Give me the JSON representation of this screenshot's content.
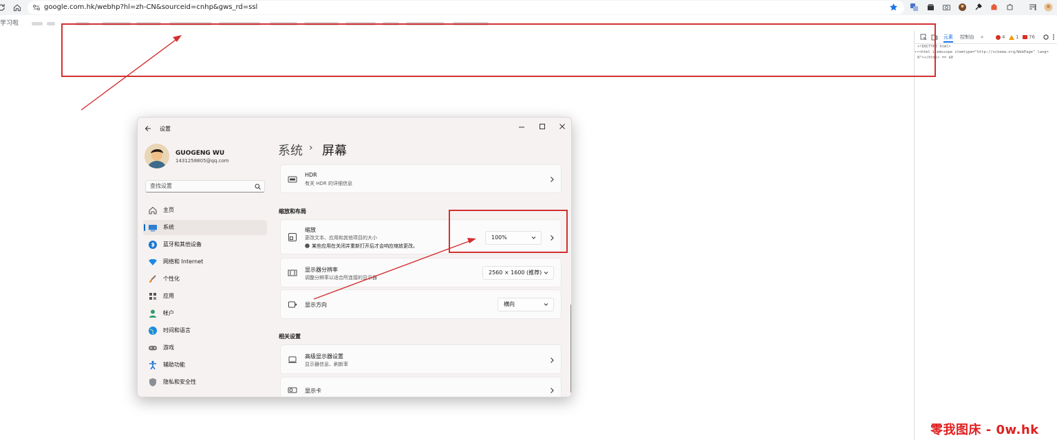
{
  "browser": {
    "url": "google.com.hk/webhp?hl=zh-CN&sourceid=cnhp&gws_rd=ssl",
    "bookmark_first": "学习啦"
  },
  "devtools": {
    "tabs": [
      "元素",
      "控制台",
      "»"
    ],
    "errors": "4",
    "warnings": "1",
    "messages": "76",
    "code_lines": [
      "<!DOCTYPE html>",
      "••<html itemscope itemtype=\"http://schema.org/WebPage\" lang=",
      "  8\"></html> == $0"
    ]
  },
  "settings": {
    "title": "设置",
    "user": {
      "name": "GUOGENG WU",
      "email": "1431258805@qq.com"
    },
    "search_placeholder": "查找设置",
    "nav": [
      {
        "label": "主页",
        "icon": "home-icon"
      },
      {
        "label": "系统",
        "icon": "system-icon",
        "selected": true
      },
      {
        "label": "蓝牙和其他设备",
        "icon": "bluetooth-icon"
      },
      {
        "label": "网络和 Internet",
        "icon": "network-icon"
      },
      {
        "label": "个性化",
        "icon": "brush-icon"
      },
      {
        "label": "应用",
        "icon": "apps-icon"
      },
      {
        "label": "帐户",
        "icon": "account-icon"
      },
      {
        "label": "时间和语言",
        "icon": "globe-icon"
      },
      {
        "label": "游戏",
        "icon": "gamepad-icon"
      },
      {
        "label": "辅助功能",
        "icon": "accessibility-icon"
      },
      {
        "label": "隐私和安全性",
        "icon": "shield-icon"
      }
    ],
    "breadcrumb": {
      "parent": "系统",
      "separator": "›",
      "current": "屏幕"
    },
    "hdr": {
      "title": "HDR",
      "subtitle": "有关 HDR 的详细信息"
    },
    "section_scale": "缩放和布局",
    "scale": {
      "title": "缩放",
      "subtitle": "更改文本、应用和其他项目的大小",
      "note": "某些应用在关闭并重新打开后才会响应缩放更改。",
      "value": "100%"
    },
    "resolution": {
      "title": "显示器分辨率",
      "subtitle": "调整分辨率以适合所连接的显示器",
      "value": "2560 × 1600 (推荐)"
    },
    "orientation": {
      "title": "显示方向",
      "value": "横向"
    },
    "section_related": "相关设置",
    "advanced": {
      "title": "高级显示器设置",
      "subtitle": "显示器信息、刷新率"
    },
    "gpu": {
      "title": "显示卡"
    }
  },
  "watermark": "零我图床 - 0w.hk",
  "colors": {
    "accent": "#0067c0",
    "annotation_red": "#d32f2f",
    "watermark": "#e02020"
  }
}
